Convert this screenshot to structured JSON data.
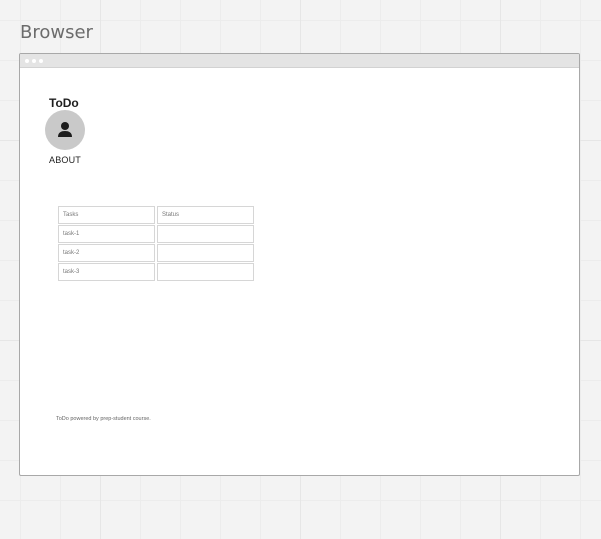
{
  "canvas": {
    "label": "Browser"
  },
  "app": {
    "title": "ToDo",
    "avatar_icon": "user-icon",
    "nav_about": "ABOUT"
  },
  "table": {
    "headers": [
      "Tasks",
      "Status"
    ],
    "rows": [
      [
        "task-1",
        ""
      ],
      [
        "task-2",
        ""
      ],
      [
        "task-3",
        ""
      ]
    ]
  },
  "footer": {
    "text": "ToDo powered by prep-student course."
  }
}
